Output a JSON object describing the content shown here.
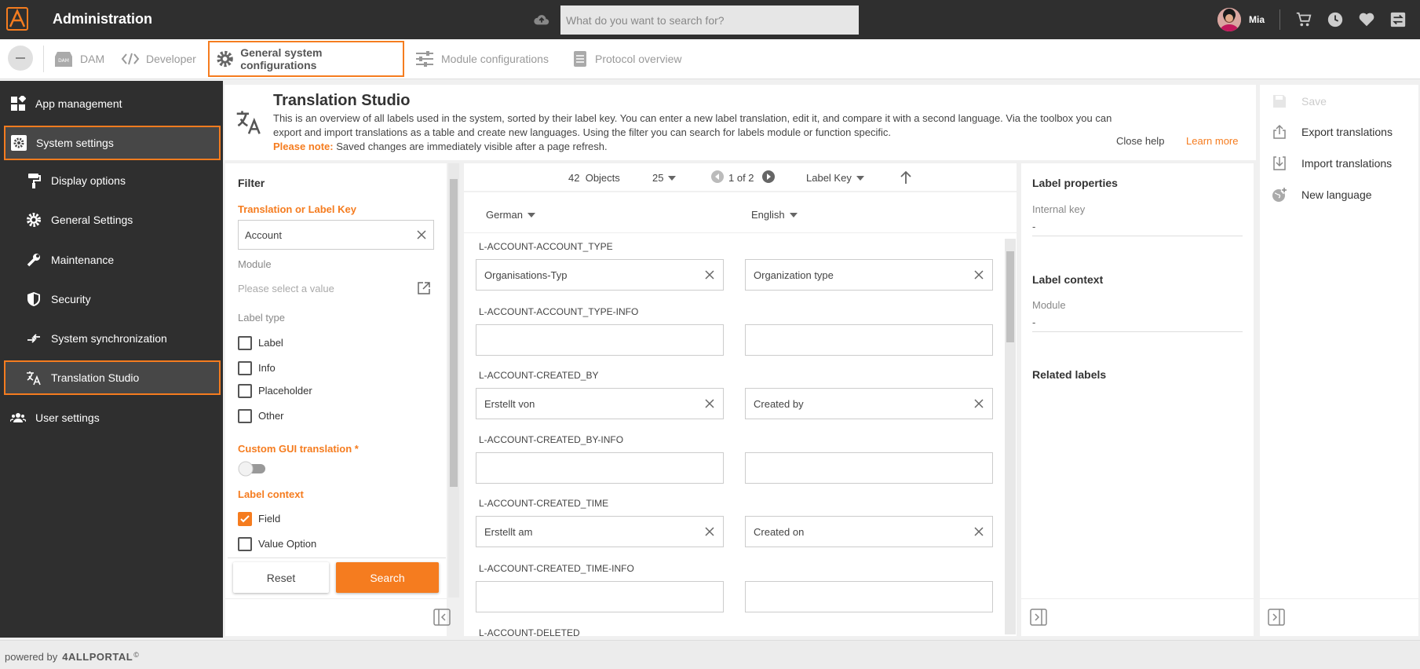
{
  "app": {
    "title": "Administration"
  },
  "search": {
    "placeholder": "What do you want to search for?"
  },
  "user": {
    "name": "Mia"
  },
  "nav": {
    "items": [
      {
        "label": "DAM"
      },
      {
        "label": "Developer"
      },
      {
        "label": "General system configurations"
      },
      {
        "label": "Module configurations"
      },
      {
        "label": "Protocol overview"
      }
    ],
    "active": "General system configurations"
  },
  "sidebar": {
    "items": [
      {
        "label": "App management"
      },
      {
        "label": "System settings"
      },
      {
        "label": "Display options"
      },
      {
        "label": "General Settings"
      },
      {
        "label": "Maintenance"
      },
      {
        "label": "Security"
      },
      {
        "label": "System synchronization"
      },
      {
        "label": "Translation Studio"
      },
      {
        "label": "User settings"
      }
    ]
  },
  "header": {
    "title": "Translation Studio",
    "text": "This is an overview of all labels used in the system, sorted by their label key. You can enter a new label translation, edit it, and compare it with a second language. Via the toolbox you can export and import translations as a table and create new languages. Using the filter you can search for labels module or function specific.",
    "note_label": "Please note:",
    "note_text": "Saved changes are immediately visible after a page refresh.",
    "close_help": "Close help",
    "learn_more": "Learn more"
  },
  "filter": {
    "title": "Filter",
    "search_label": "Translation or Label Key",
    "search_value": "Account",
    "module_label": "Module",
    "module_placeholder": "Please select a value",
    "label_type_label": "Label type",
    "label_types": [
      "Label",
      "Info",
      "Placeholder",
      "Other"
    ],
    "custom_gui_label": "Custom GUI translation *",
    "custom_gui_on": false,
    "label_context_label": "Label context",
    "contexts": [
      {
        "label": "Field",
        "checked": true
      },
      {
        "label": "Value Option",
        "checked": false
      }
    ],
    "reset": "Reset",
    "search": "Search"
  },
  "list": {
    "count": "42",
    "objects_label": "Objects",
    "page_size": "25",
    "page": "1 of 2",
    "sort_by": "Label Key",
    "lang_left": "German",
    "lang_right": "English",
    "rows": [
      {
        "key": "L-ACCOUNT-ACCOUNT_TYPE",
        "de": "Organisations-Typ",
        "en": "Organization type"
      },
      {
        "key": "L-ACCOUNT-ACCOUNT_TYPE-INFO",
        "de": "",
        "en": ""
      },
      {
        "key": "L-ACCOUNT-CREATED_BY",
        "de": "Erstellt von",
        "en": "Created by"
      },
      {
        "key": "L-ACCOUNT-CREATED_BY-INFO",
        "de": "",
        "en": ""
      },
      {
        "key": "L-ACCOUNT-CREATED_TIME",
        "de": "Erstellt am",
        "en": "Created on"
      },
      {
        "key": "L-ACCOUNT-CREATED_TIME-INFO",
        "de": "",
        "en": ""
      },
      {
        "key": "L-ACCOUNT-DELETED",
        "de": "",
        "en": ""
      }
    ]
  },
  "props": {
    "title": "Label properties",
    "internal_key_label": "Internal key",
    "internal_key_value": "-",
    "context_title": "Label context",
    "module_label": "Module",
    "module_value": "-",
    "related_title": "Related labels"
  },
  "tools": {
    "save": "Save",
    "export": "Export translations",
    "import": "Import translations",
    "new_language": "New language"
  },
  "footer": {
    "powered_by": "powered by",
    "brand": "4ALLPORTAL",
    "mark": "©"
  },
  "colors": {
    "accent": "#f57c1f",
    "dark": "#2f2f2f"
  }
}
